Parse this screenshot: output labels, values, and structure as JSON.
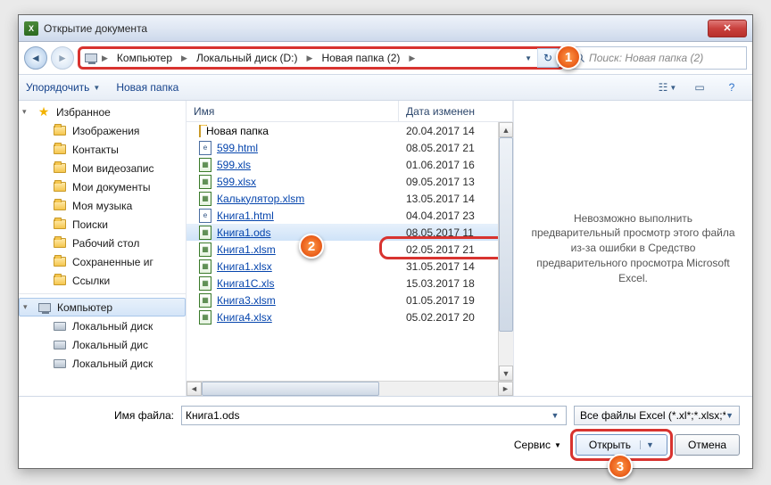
{
  "titlebar": {
    "title": "Открытие документа"
  },
  "breadcrumbs": [
    "Компьютер",
    "Локальный диск (D:)",
    "Новая папка (2)"
  ],
  "search_placeholder": "Поиск: Новая папка (2)",
  "toolbar": {
    "organize": "Упорядочить",
    "newfolder": "Новая папка"
  },
  "nav": {
    "favorites": "Избранное",
    "items1": [
      "Изображения",
      "Контакты",
      "Мои видеозапис",
      "Мои документы",
      "Моя музыка",
      "Поиски",
      "Рабочий стол",
      "Сохраненные иг",
      "Ссылки"
    ],
    "computer": "Компьютер",
    "drives": [
      "Локальный диск",
      "Локальный дис",
      "Локальный диск"
    ]
  },
  "columns": {
    "name": "Имя",
    "date": "Дата изменен"
  },
  "files": [
    {
      "icon": "folder",
      "name": "Новая папка",
      "date": "20.04.2017 14",
      "sel": false,
      "link": false
    },
    {
      "icon": "html",
      "name": "599.html",
      "date": "08.05.2017 21",
      "sel": false,
      "link": true
    },
    {
      "icon": "xls",
      "name": "599.xls",
      "date": "01.06.2017 16",
      "sel": false,
      "link": true
    },
    {
      "icon": "xls",
      "name": "599.xlsx",
      "date": "09.05.2017 13",
      "sel": false,
      "link": true
    },
    {
      "icon": "xls",
      "name": "Калькулятор.xlsm",
      "date": "13.05.2017 14",
      "sel": false,
      "link": true
    },
    {
      "icon": "html",
      "name": "Книга1.html",
      "date": "04.04.2017 23",
      "sel": false,
      "link": true
    },
    {
      "icon": "ods",
      "name": "Книга1.ods",
      "date": "08.05.2017 11",
      "sel": true,
      "link": true
    },
    {
      "icon": "xls",
      "name": "Книга1.xlsm",
      "date": "02.05.2017 21",
      "sel": false,
      "link": true
    },
    {
      "icon": "xls",
      "name": "Книга1.xlsx",
      "date": "31.05.2017 14",
      "sel": false,
      "link": true
    },
    {
      "icon": "xls",
      "name": "Книга1C.xls",
      "date": "15.03.2017 18",
      "sel": false,
      "link": true
    },
    {
      "icon": "xls",
      "name": "Книга3.xlsm",
      "date": "01.05.2017 19",
      "sel": false,
      "link": true
    },
    {
      "icon": "xls",
      "name": "Книга4.xlsx",
      "date": "05.02.2017 20",
      "sel": false,
      "link": true
    }
  ],
  "preview_text": "Невозможно выполнить предварительный просмотр этого файла из-за ошибки в Средство предварительного просмотра Microsoft Excel.",
  "footer": {
    "filename_label": "Имя файла:",
    "filename_value": "Книга1.ods",
    "filter": "Все файлы Excel (*.xl*;*.xlsx;*.xl",
    "service": "Сервис",
    "open": "Открыть",
    "cancel": "Отмена"
  },
  "badges": {
    "1": "1",
    "2": "2",
    "3": "3"
  }
}
